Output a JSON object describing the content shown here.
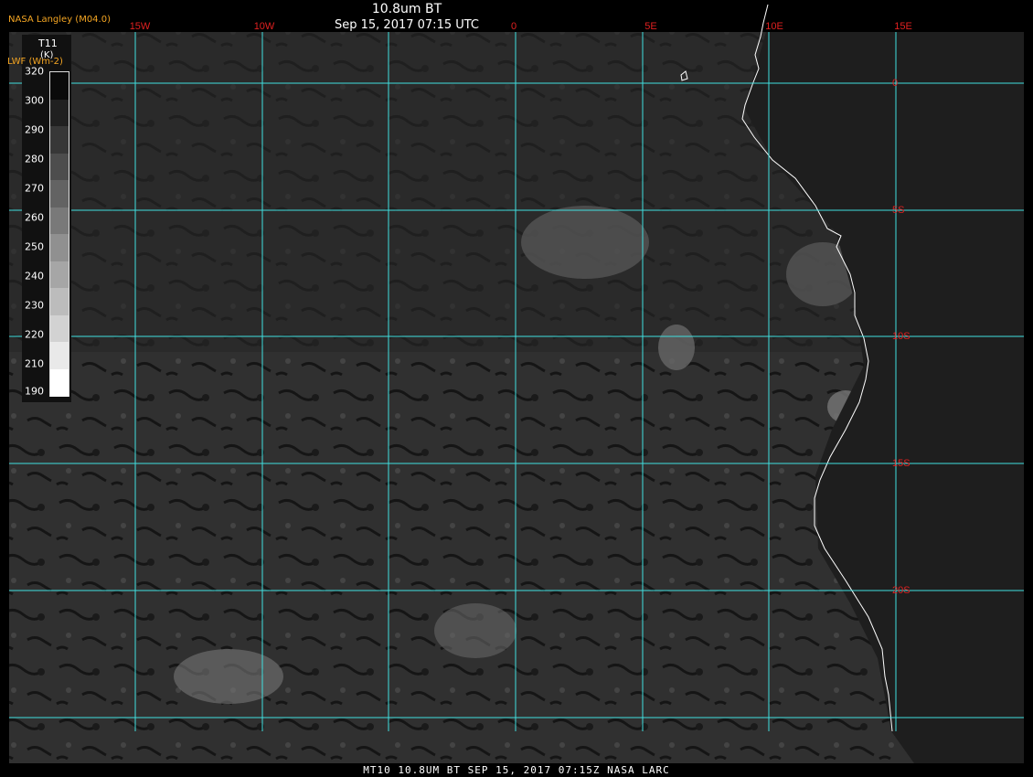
{
  "header": {
    "credit": "NASA Langley (M04.0)",
    "title": "10.8um BT",
    "date": "Sep 15, 2017 07:15 UTC"
  },
  "footer": {
    "text": "MT10  10.8UM BT  SEP 15, 2017 07:15Z  NASA LARC"
  },
  "legend": {
    "title": "T11",
    "unit": "(K)",
    "subtitle": "LWF (Wm-2)",
    "ticks": [
      "320",
      "300",
      "290",
      "280",
      "270",
      "260",
      "250",
      "240",
      "230",
      "220",
      "210",
      "190"
    ],
    "colors": {
      "warm": "#000000",
      "cold": "#ffffff"
    }
  },
  "grid": {
    "color": "#40e0e0",
    "label_color": "#e02020",
    "lon_labels": [
      "15W",
      "10W",
      "0",
      "5E",
      "10E",
      "15E"
    ],
    "lat_labels": [
      "0",
      "5S",
      "10S",
      "15S",
      "20S"
    ]
  },
  "colors": {
    "ocean": "#2a2a2a",
    "land": "#3c3c3c",
    "coastline": "#ffffff"
  }
}
